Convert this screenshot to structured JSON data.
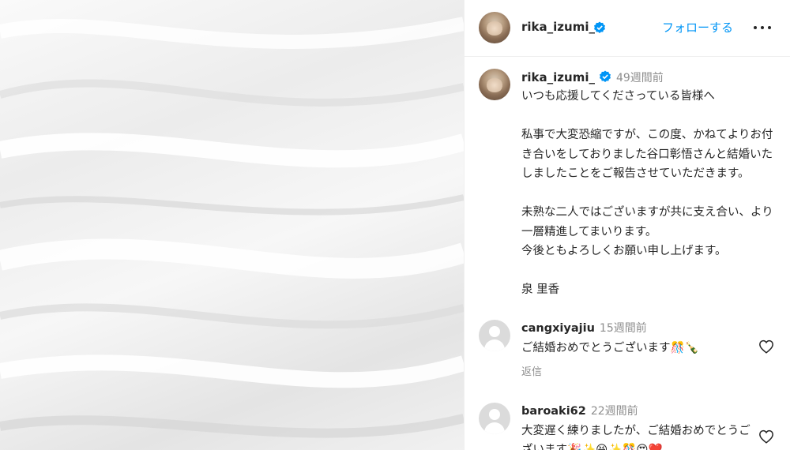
{
  "post": {
    "image_icon": "white-fabric-photo"
  },
  "header": {
    "username": "rika_izumi_",
    "verified_icon": "verified-badge-icon",
    "follow_label": "フォローする",
    "more_icon": "more-options-icon"
  },
  "caption": {
    "username": "rika_izumi_",
    "time": "49週間前",
    "text": "いつも応援してくださっている皆様へ\n\n私事で大変恐縮ですが、この度、かねてよりお付き合いをしておりました谷口彰悟さんと結婚いたしましたことをご報告させていただきます。\n\n未熟な二人ではございますが共に支え合い、より一層精進してまいります。\n今後ともよろしくお願い申し上げます。\n\n泉 里香"
  },
  "comments": [
    {
      "username": "cangxiyajiu",
      "time": "15週間前",
      "text": "ご結婚おめでとうございます🎊🍾",
      "reply_label": "返信"
    },
    {
      "username": "baroaki62",
      "time": "22週間前",
      "text": "大変遅く練りましたが、ご結婚おめでとうございます🎉✨😆✨🎊😍❤️"
    }
  ],
  "colors": {
    "accent": "#0095f6",
    "verified": "#0095f6",
    "muted": "#8e8e8e"
  }
}
